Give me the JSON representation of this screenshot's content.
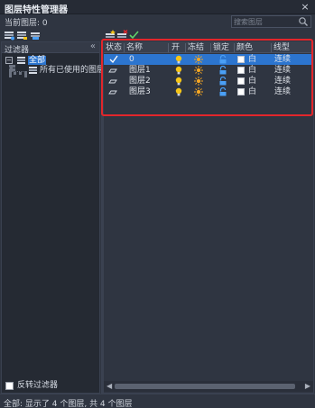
{
  "window": {
    "title": "图层特性管理器",
    "close_label": "×"
  },
  "current_layer": {
    "label": "当前图层: 0"
  },
  "search": {
    "placeholder": "搜索图层"
  },
  "toolbar": {
    "icons": [
      "new-property-filter-icon",
      "new-group-filter-icon",
      "layer-states-manager-icon",
      "new-layer-icon",
      "delete-layer-icon",
      "set-current-icon"
    ]
  },
  "filter_panel": {
    "header": "过滤器",
    "collapse_label": "«",
    "tree": {
      "root": {
        "label": "全部",
        "expanded": true,
        "selected": true
      },
      "children": [
        {
          "label": "所有已使用的图层"
        }
      ]
    },
    "invert_filter": {
      "label": "反转过滤器",
      "checked": false
    }
  },
  "layer_grid": {
    "columns": [
      "状态",
      "名称",
      "开",
      "冻结",
      "锁定",
      "颜色",
      "线型"
    ],
    "rows": [
      {
        "status": "current",
        "name": "0",
        "on": true,
        "frozen": false,
        "locked": false,
        "color_name": "白",
        "color_hex": "#ffffff",
        "linetype": "连续",
        "selected": true
      },
      {
        "status": "layer",
        "name": "图层1",
        "on": true,
        "frozen": false,
        "locked": false,
        "color_name": "白",
        "color_hex": "#ffffff",
        "linetype": "连续",
        "selected": false
      },
      {
        "status": "layer",
        "name": "图层2",
        "on": true,
        "frozen": false,
        "locked": false,
        "color_name": "白",
        "color_hex": "#ffffff",
        "linetype": "连续",
        "selected": false
      },
      {
        "status": "layer",
        "name": "图层3",
        "on": true,
        "frozen": false,
        "locked": false,
        "color_name": "白",
        "color_hex": "#ffffff",
        "linetype": "连续",
        "selected": false
      }
    ]
  },
  "status_bar": {
    "text": "全部:  显示了 4 个图层, 共 4 个图层"
  },
  "colors": {
    "accent": "#2c75cf",
    "highlight_frame": "#e3262b",
    "bulb": "#f5c518",
    "sun": "#f5a623",
    "lock": "#4a9ff5",
    "background": "#2f3541"
  }
}
